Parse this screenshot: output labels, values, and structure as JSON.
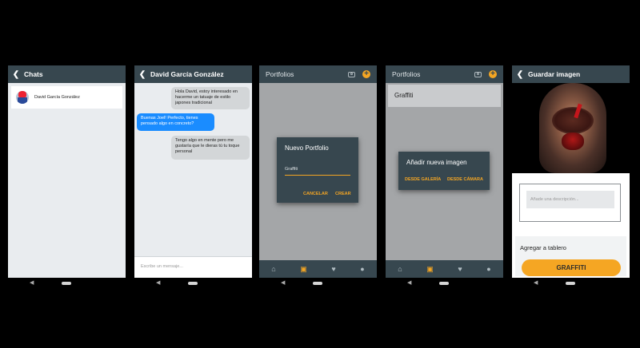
{
  "screen1": {
    "title": "Chats",
    "contact_name": "David García González"
  },
  "screen2": {
    "title": "David García González",
    "messages": [
      "Hola David, estoy interesado en hacerme un tatuaje de estilo japones tradicional",
      "Buenas Joel! Perfecto, tienes pensado algo en concreto?",
      "Tengo algo en mente pero me gustaría que le dieras tú tu toque personal"
    ],
    "input_placeholder": "Escribe un mensaje..."
  },
  "screen3": {
    "title": "Portfolios",
    "dialog_title": "Nuevo Portfolio",
    "dialog_value": "Graffiti",
    "cancel_label": "CANCELAR",
    "create_label": "CREAR"
  },
  "screen4": {
    "title": "Portfolios",
    "list_item": "Graffiti",
    "dialog_title": "Añadir nueva imagen",
    "gallery_label": "DESDE GALERÍA",
    "camera_label": "DESDE CÁMARA"
  },
  "screen5": {
    "title": "Guardar imagen",
    "description_placeholder": "Añade una descripción...",
    "board_label": "Agregar a tablero",
    "board_button": "GRAFFITI"
  },
  "colors": {
    "appbar": "#37474f",
    "accent": "#f5a623",
    "bubble_out": "#1a8cff"
  }
}
